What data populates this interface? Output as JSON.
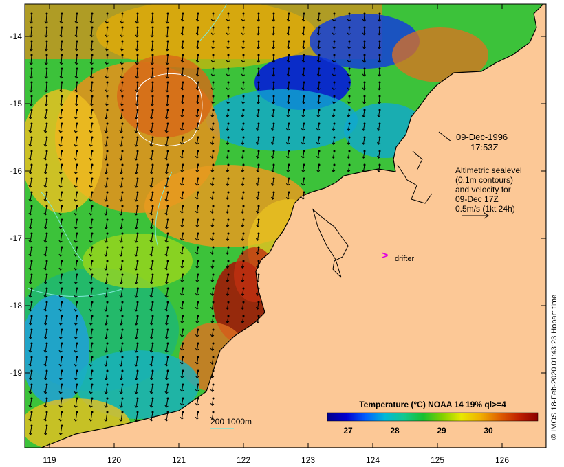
{
  "map": {
    "x_ticks": [
      "119",
      "120",
      "121",
      "122",
      "123",
      "124",
      "125",
      "126"
    ],
    "y_ticks": [
      "-14",
      "-15",
      "-16",
      "-17",
      "-18",
      "-19"
    ],
    "colors": {
      "land": "#fcc896",
      "coast": "#000000",
      "contour": "#7fe8d8",
      "arrow": "#000000",
      "drifter": "#e000e0"
    }
  },
  "annotations": {
    "date": "09-Dec-1996",
    "time": "17:53Z",
    "legend_lines": [
      "Altimetric sealevel",
      "(0.1m contours)",
      "and velocity for",
      "09-Dec 17Z",
      "0.5m/s (1kt 24h)"
    ],
    "drifter_label": "drifter",
    "drifter_marker": ">",
    "contour_legend": "200  1000m"
  },
  "colorbar": {
    "title": "Temperature (°C) NOAA 14 19% ql>=4",
    "ticks": [
      "27",
      "28",
      "29",
      "30"
    ],
    "stops": [
      "#00008b",
      "#0000d0",
      "#0060ff",
      "#00b8d8",
      "#10c890",
      "#18c030",
      "#80d000",
      "#e8e800",
      "#f0b000",
      "#e06000",
      "#c02000",
      "#8b0000"
    ]
  },
  "credit": "© IMOS 18-Feb-2020 01:43:23 Hobart time"
}
